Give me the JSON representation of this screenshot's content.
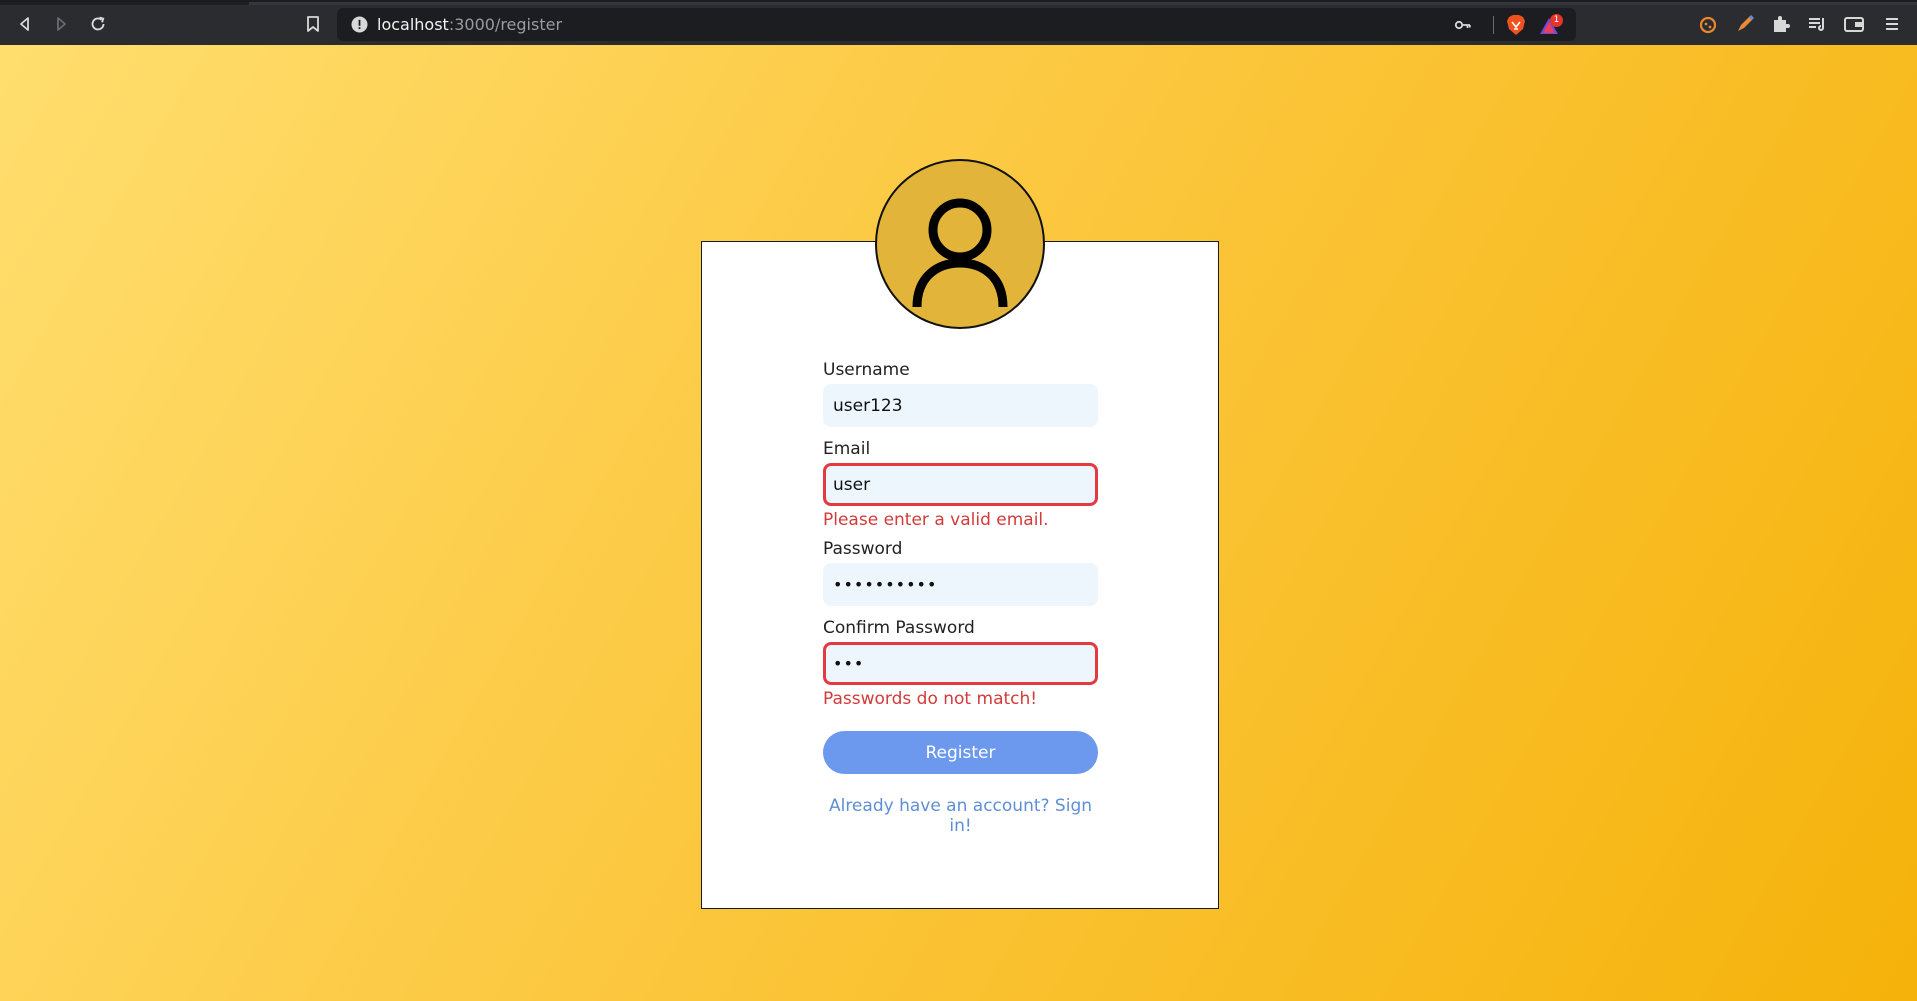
{
  "browser": {
    "url_host": "localhost",
    "url_path": ":3000/register",
    "notification_count": "1"
  },
  "register_form": {
    "username": {
      "label": "Username",
      "value": "user123"
    },
    "email": {
      "label": "Email",
      "value": "user",
      "error": "Please enter a valid email."
    },
    "password": {
      "label": "Password",
      "value": "••••••••••"
    },
    "confirm_password": {
      "label": "Confirm Password",
      "value": "•••",
      "error": "Passwords do not match!"
    },
    "submit_label": "Register",
    "signin_link": "Already have an account? Sign in!"
  },
  "icons": {
    "avatar": "user-icon"
  },
  "colors": {
    "background_start": "#ffde6e",
    "background_end": "#f5b20a",
    "avatar_fill": "#e2b43a",
    "error": "#e23a40",
    "button": "#6c98ee",
    "link": "#5d8fd6",
    "input_bg": "#eef6fd"
  }
}
